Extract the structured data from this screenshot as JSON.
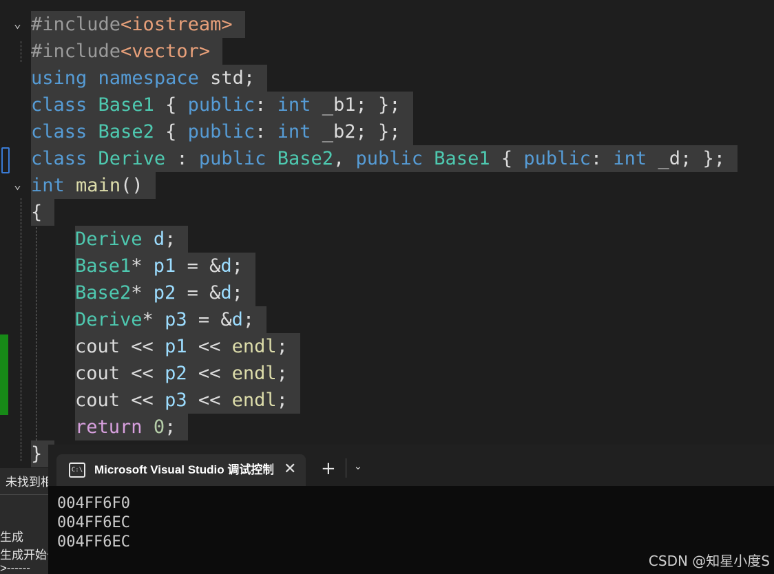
{
  "editor": {
    "lines": [
      {
        "tokens": [
          {
            "t": "#include",
            "c": "pre"
          },
          {
            "t": "<iostream>",
            "c": "inc"
          }
        ]
      },
      {
        "tokens": [
          {
            "t": "#include",
            "c": "pre"
          },
          {
            "t": "<vector>",
            "c": "inc"
          }
        ]
      },
      {
        "tokens": [
          {
            "t": "using",
            "c": "kw"
          },
          {
            "t": " ",
            "c": "pl"
          },
          {
            "t": "namespace",
            "c": "kw"
          },
          {
            "t": " std;",
            "c": "pl"
          }
        ]
      },
      {
        "tokens": [
          {
            "t": "class",
            "c": "kw"
          },
          {
            "t": " ",
            "c": "pl"
          },
          {
            "t": "Base1",
            "c": "type"
          },
          {
            "t": " { ",
            "c": "pl"
          },
          {
            "t": "public",
            "c": "kw"
          },
          {
            "t": ": ",
            "c": "pl"
          },
          {
            "t": "int",
            "c": "kw"
          },
          {
            "t": " _b1; };",
            "c": "pl"
          }
        ]
      },
      {
        "tokens": [
          {
            "t": "class",
            "c": "kw"
          },
          {
            "t": " ",
            "c": "pl"
          },
          {
            "t": "Base2",
            "c": "type"
          },
          {
            "t": " { ",
            "c": "pl"
          },
          {
            "t": "public",
            "c": "kw"
          },
          {
            "t": ": ",
            "c": "pl"
          },
          {
            "t": "int",
            "c": "kw"
          },
          {
            "t": " _b2; };",
            "c": "pl"
          }
        ]
      },
      {
        "tokens": [
          {
            "t": "class",
            "c": "kw"
          },
          {
            "t": " ",
            "c": "pl"
          },
          {
            "t": "Derive",
            "c": "type"
          },
          {
            "t": " : ",
            "c": "pl"
          },
          {
            "t": "public",
            "c": "kw"
          },
          {
            "t": " ",
            "c": "pl"
          },
          {
            "t": "Base2",
            "c": "type"
          },
          {
            "t": ", ",
            "c": "pl"
          },
          {
            "t": "public",
            "c": "kw"
          },
          {
            "t": " ",
            "c": "pl"
          },
          {
            "t": "Base1",
            "c": "type"
          },
          {
            "t": " { ",
            "c": "pl"
          },
          {
            "t": "public",
            "c": "kw"
          },
          {
            "t": ": ",
            "c": "pl"
          },
          {
            "t": "int",
            "c": "kw"
          },
          {
            "t": " _d; };",
            "c": "pl"
          }
        ]
      },
      {
        "tokens": [
          {
            "t": "int",
            "c": "kw"
          },
          {
            "t": " ",
            "c": "pl"
          },
          {
            "t": "main",
            "c": "fn"
          },
          {
            "t": "()",
            "c": "pl"
          }
        ]
      },
      {
        "tokens": [
          {
            "t": "{",
            "c": "pl"
          }
        ]
      },
      {
        "tokens": [
          {
            "t": "Derive",
            "c": "type"
          },
          {
            "t": " ",
            "c": "pl"
          },
          {
            "t": "d",
            "c": "var"
          },
          {
            "t": ";",
            "c": "pl"
          }
        ]
      },
      {
        "tokens": [
          {
            "t": "Base1",
            "c": "type"
          },
          {
            "t": "* ",
            "c": "pl"
          },
          {
            "t": "p1",
            "c": "var"
          },
          {
            "t": " = &",
            "c": "pl"
          },
          {
            "t": "d",
            "c": "var"
          },
          {
            "t": ";",
            "c": "pl"
          }
        ]
      },
      {
        "tokens": [
          {
            "t": "Base2",
            "c": "type"
          },
          {
            "t": "* ",
            "c": "pl"
          },
          {
            "t": "p2",
            "c": "var"
          },
          {
            "t": " = &",
            "c": "pl"
          },
          {
            "t": "d",
            "c": "var"
          },
          {
            "t": ";",
            "c": "pl"
          }
        ]
      },
      {
        "tokens": [
          {
            "t": "Derive",
            "c": "type"
          },
          {
            "t": "* ",
            "c": "pl"
          },
          {
            "t": "p3",
            "c": "var"
          },
          {
            "t": " = &",
            "c": "pl"
          },
          {
            "t": "d",
            "c": "var"
          },
          {
            "t": ";",
            "c": "pl"
          }
        ]
      },
      {
        "tokens": [
          {
            "t": "cout",
            "c": "pl"
          },
          {
            "t": " << ",
            "c": "pl"
          },
          {
            "t": "p1",
            "c": "var"
          },
          {
            "t": " << ",
            "c": "pl"
          },
          {
            "t": "endl",
            "c": "fn"
          },
          {
            "t": ";",
            "c": "pl"
          }
        ]
      },
      {
        "tokens": [
          {
            "t": "cout",
            "c": "pl"
          },
          {
            "t": " << ",
            "c": "pl"
          },
          {
            "t": "p2",
            "c": "var"
          },
          {
            "t": " << ",
            "c": "pl"
          },
          {
            "t": "endl",
            "c": "fn"
          },
          {
            "t": ";",
            "c": "pl"
          }
        ]
      },
      {
        "tokens": [
          {
            "t": "cout",
            "c": "pl"
          },
          {
            "t": " << ",
            "c": "pl"
          },
          {
            "t": "p3",
            "c": "var"
          },
          {
            "t": " << ",
            "c": "pl"
          },
          {
            "t": "endl",
            "c": "fn"
          },
          {
            "t": ";",
            "c": "pl"
          }
        ]
      },
      {
        "tokens": [
          {
            "t": "return",
            "c": "ctl"
          },
          {
            "t": " ",
            "c": "pl"
          },
          {
            "t": "0",
            "c": "num"
          },
          {
            "t": ";",
            "c": "pl"
          }
        ]
      },
      {
        "tokens": [
          {
            "t": "}",
            "c": "pl"
          }
        ]
      }
    ]
  },
  "behind_panel": {
    "line1": "未找到相",
    "line2": "生成",
    "line3": "生成开始于",
    "line4": ">------"
  },
  "console": {
    "tab_title": "Microsoft Visual Studio 调试控制台",
    "tab_icon_text": "C:\\",
    "close_glyph": "✕",
    "new_tab_glyph": "+",
    "dropdown_glyph": "⌄",
    "output": [
      "004FF6F0",
      "004FF6EC",
      "004FF6EC"
    ]
  },
  "watermark": "CSDN @知星小度S",
  "colors": {
    "keyword": "#569cd6",
    "type": "#4ec9b0",
    "function": "#dcdcaa",
    "variable": "#9cdcfe",
    "control": "#d8a0df",
    "number": "#b5cea8",
    "include": "#e8a07a",
    "preprocessor": "#9b9b9b",
    "change_bar": "#178a17"
  }
}
